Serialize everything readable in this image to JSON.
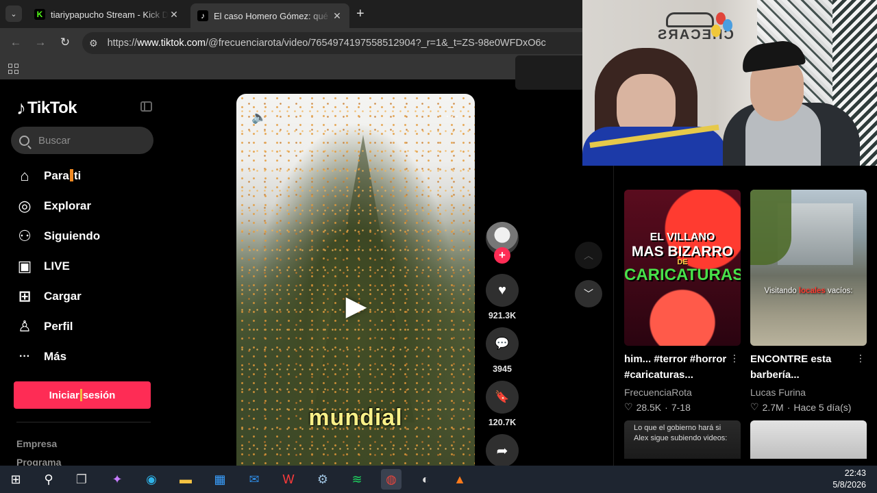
{
  "browser": {
    "tabs": [
      {
        "title": "tiariypapucho Stream - Kick Da",
        "favicon_text": "K",
        "favicon_color": "#53fc18",
        "close": "✕"
      },
      {
        "title": "El caso Homero Gómez: qué pa",
        "favicon_text": "♪",
        "favicon_color": "#000000",
        "close": "✕"
      }
    ],
    "tab_menu": "⌄",
    "new_tab": "+",
    "nav": {
      "back": "←",
      "forward": "→",
      "reload": "↻"
    },
    "url_scheme": "https://",
    "url_host": "www.tiktok.com",
    "url_path": "/@frecuenciarota/video/7654974197558512904?_r=1&_t=ZS-98e0WFDxO6c"
  },
  "tiktok": {
    "logo": "TikTok",
    "search_placeholder": "Buscar",
    "nav": [
      {
        "label_a": "Para",
        "label_b": "ti",
        "icon": "⌂"
      },
      {
        "label": "Explorar",
        "icon": "◎"
      },
      {
        "label": "Siguiendo",
        "icon": "⚇"
      },
      {
        "label": "LIVE",
        "icon": "▣"
      },
      {
        "label": "Cargar",
        "icon": "⊞"
      },
      {
        "label": "Perfil",
        "icon": "♙"
      },
      {
        "label": "Más",
        "icon": "···"
      }
    ],
    "login_a": "Iniciar",
    "login_b": "sesión",
    "footer": [
      "Empresa",
      "Programa"
    ]
  },
  "video": {
    "caption": "mundial",
    "play_icon": "▶",
    "sound_icon": "🔈",
    "more_icon": "···",
    "follow_plus": "+",
    "actions": [
      {
        "icon": "♥",
        "count": "921.3K"
      },
      {
        "icon": "💬",
        "count": "3945"
      },
      {
        "icon": "🔖",
        "count": "120.7K"
      },
      {
        "icon": "➦",
        "count": ""
      }
    ],
    "scroll_up": "︿",
    "scroll_down": "﹀"
  },
  "webcam": {
    "sign": "CHECARS"
  },
  "recommended": [
    {
      "thumb_line1": "EL VILLANO",
      "thumb_line2": "MAS BIZARRO",
      "thumb_line3": "DE",
      "thumb_line4": "CARICATURAS",
      "title": "him... #terror #horror #caricaturas...",
      "author": "FrecuenciaRota",
      "likes": "28.5K",
      "date": "7-18"
    },
    {
      "thumb_text_a": "Visitando",
      "thumb_text_b": "locales",
      "thumb_text_c": "vacíos:",
      "title": "ENCONTRE esta barbería...",
      "author": "Lucas Furina",
      "likes": "2.7M",
      "date": "Hace 5 día(s)"
    }
  ],
  "recommended_more": {
    "thumb3_text": "Lo que el gobierno hará si Alex sigue subiendo videos:"
  },
  "taskbar": {
    "time": "22:43",
    "date": "5/8/2026",
    "apps": [
      {
        "name": "start",
        "glyph": "⊞",
        "color": "#ffffff"
      },
      {
        "name": "search",
        "glyph": "⚲",
        "color": "#ffffff"
      },
      {
        "name": "task-view",
        "glyph": "❐",
        "color": "#cccccc"
      },
      {
        "name": "copilot",
        "glyph": "✦",
        "color": "#c77dff"
      },
      {
        "name": "edge",
        "glyph": "◉",
        "color": "#2fb3e8"
      },
      {
        "name": "explorer",
        "glyph": "▬",
        "color": "#f5c242"
      },
      {
        "name": "store",
        "glyph": "▦",
        "color": "#3aa0ff"
      },
      {
        "name": "outlook",
        "glyph": "✉",
        "color": "#2f8ae0"
      },
      {
        "name": "wps",
        "glyph": "W",
        "color": "#ff3b3b"
      },
      {
        "name": "steam",
        "glyph": "⚙",
        "color": "#9fc3e0"
      },
      {
        "name": "spotify",
        "glyph": "≋",
        "color": "#1ed760"
      },
      {
        "name": "chrome",
        "glyph": "◍",
        "color": "#e8453c"
      },
      {
        "name": "obs",
        "glyph": "◐",
        "color": "#dddddd"
      },
      {
        "name": "app",
        "glyph": "▲",
        "color": "#ff7a1a"
      }
    ]
  }
}
